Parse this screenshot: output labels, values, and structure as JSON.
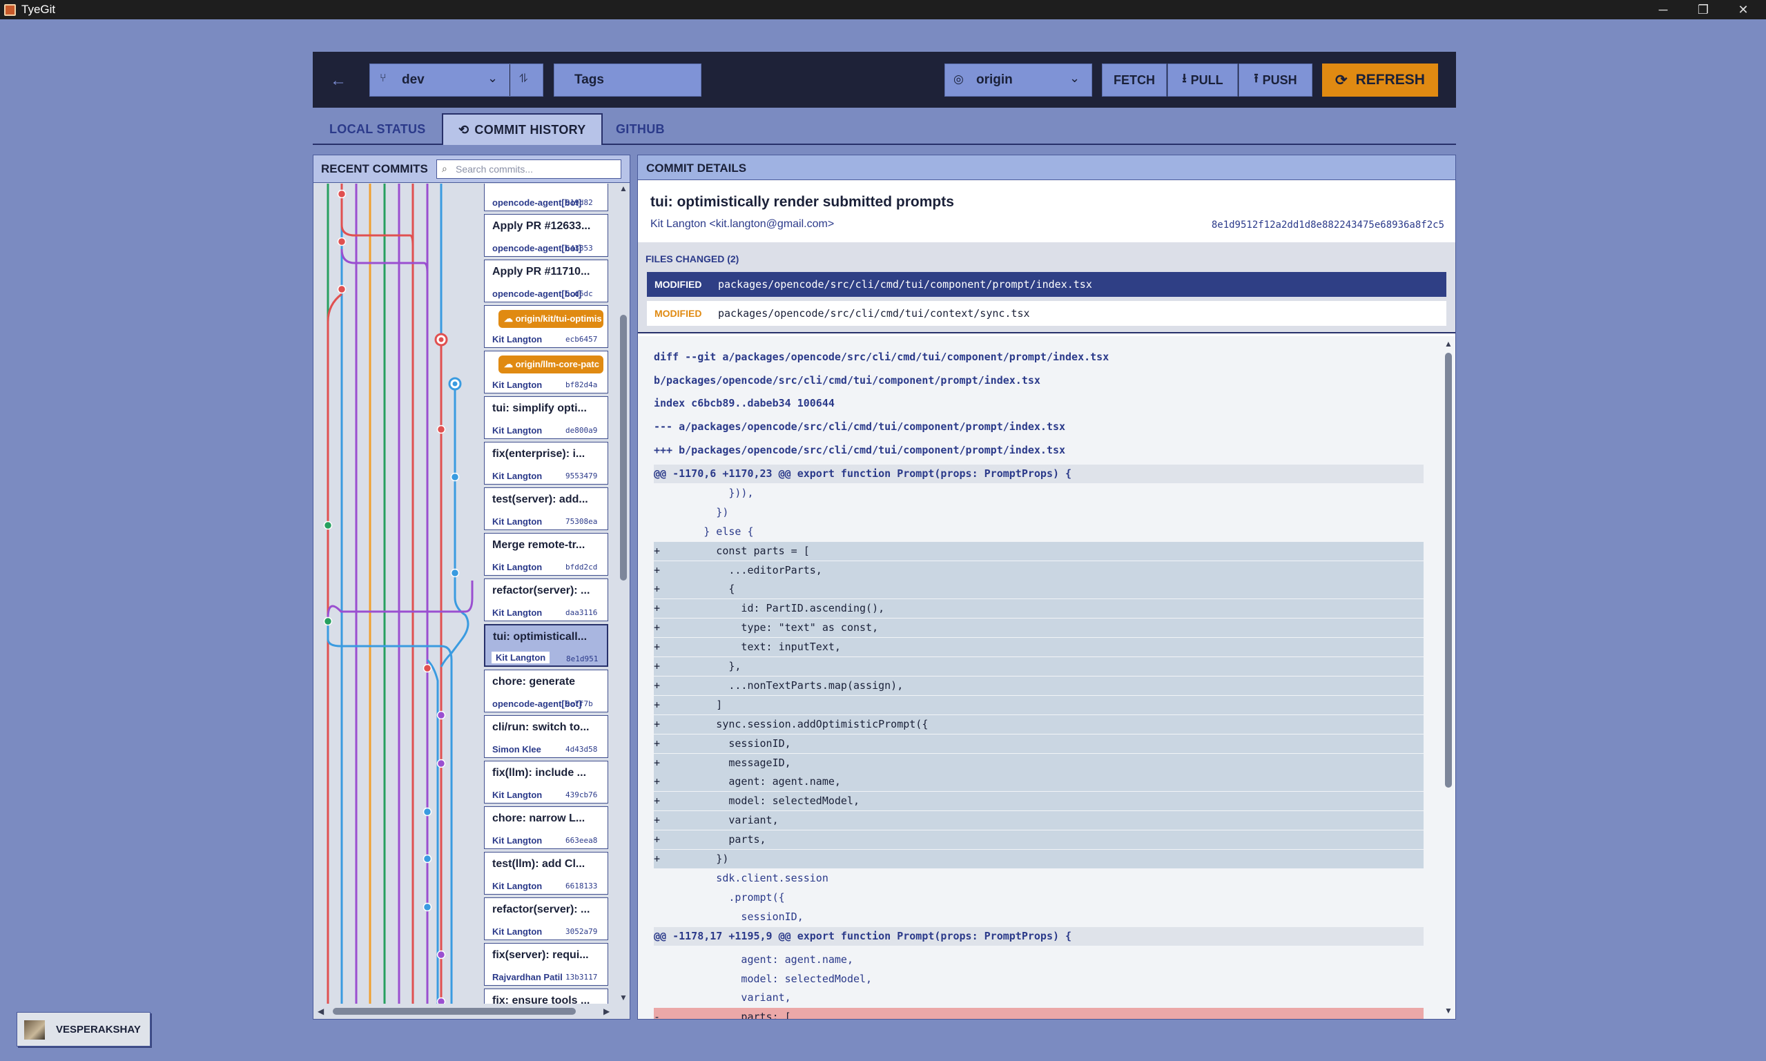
{
  "window": {
    "title": "TyeGit",
    "controls": [
      "─",
      "❐",
      "✕"
    ]
  },
  "toolbar": {
    "branch": "dev",
    "tags_label": "Tags",
    "remote": "origin",
    "fetch_label": "FETCH",
    "pull_label": "PULL",
    "push_label": "PUSH",
    "refresh_label": "REFRESH",
    "accent": "#e08a12"
  },
  "tabs": [
    {
      "label": "LOCAL STATUS"
    },
    {
      "label": "COMMIT HISTORY",
      "active": true
    },
    {
      "label": "GITHUB"
    }
  ],
  "recent_commits": {
    "title": "RECENT COMMITS",
    "search_placeholder": "Search commits...",
    "items": [
      {
        "message": "",
        "author": "opencode-agent[bot]",
        "hash": "919d82"
      },
      {
        "message": "Apply PR #12633...",
        "author": "opencode-agent[bot]",
        "hash": "643853"
      },
      {
        "message": "Apply PR #11710...",
        "author": "opencode-agent[bot]",
        "hash": "5cd6dc"
      },
      {
        "ref": "origin/kit/tui-optimis",
        "author": "Kit Langton",
        "hash": "ecb6457"
      },
      {
        "ref": "origin/llm-core-patc",
        "author": "Kit Langton",
        "hash": "bf82d4a"
      },
      {
        "message": "tui: simplify opti...",
        "author": "Kit Langton",
        "hash": "de800a9"
      },
      {
        "message": "fix(enterprise): i...",
        "author": "Kit Langton",
        "hash": "9553479"
      },
      {
        "message": "test(server): add...",
        "author": "Kit Langton",
        "hash": "75308ea"
      },
      {
        "message": "Merge remote-tr...",
        "author": "Kit Langton",
        "hash": "bfdd2cd"
      },
      {
        "message": "refactor(server): ...",
        "author": "Kit Langton",
        "hash": "daa3116"
      },
      {
        "message": "tui: optimisticall...",
        "author": "Kit Langton",
        "hash": "8e1d951",
        "selected": true
      },
      {
        "message": "chore: generate",
        "author": "opencode-agent[bot]",
        "hash": "9e7f7b"
      },
      {
        "message": "cli/run: switch to...",
        "author": "Simon Klee",
        "hash": "4d43d58"
      },
      {
        "message": "fix(llm): include ...",
        "author": "Kit Langton",
        "hash": "439cb76"
      },
      {
        "message": "chore: narrow L...",
        "author": "Kit Langton",
        "hash": "663eea8"
      },
      {
        "message": "test(llm): add Cl...",
        "author": "Kit Langton",
        "hash": "6618133"
      },
      {
        "message": "refactor(server): ...",
        "author": "Kit Langton",
        "hash": "3052a79"
      },
      {
        "message": "fix(server): requi...",
        "author": "Rajvardhan Patil",
        "hash": "13b3117"
      },
      {
        "message": "fix: ensure tools ...",
        "author": "",
        "hash": ""
      }
    ]
  },
  "commit_details": {
    "title": "COMMIT DETAILS",
    "commit_title": "tui: optimistically render submitted prompts",
    "author": "Kit Langton <kit.langton@gmail.com>",
    "hash": "8e1d9512f12a2dd1d8e882243475e68936a8f2c5",
    "files_title": "FILES CHANGED (2)",
    "files": [
      {
        "status": "MODIFIED",
        "path": "packages/opencode/src/cli/cmd/tui/component/prompt/index.tsx",
        "selected": true
      },
      {
        "status": "MODIFIED",
        "path": "packages/opencode/src/cli/cmd/tui/context/sync.tsx"
      }
    ],
    "diff_lines": [
      {
        "kind": "hdr",
        "text": "diff --git a/packages/opencode/src/cli/cmd/tui/component/prompt/index.tsx"
      },
      {
        "kind": "hdr",
        "text": "b/packages/opencode/src/cli/cmd/tui/component/prompt/index.tsx"
      },
      {
        "kind": "hdr",
        "text": "index c6bcb89..dabeb34 100644"
      },
      {
        "kind": "hdr",
        "text": "--- a/packages/opencode/src/cli/cmd/tui/component/prompt/index.tsx"
      },
      {
        "kind": "hdr",
        "text": "+++ b/packages/opencode/src/cli/cmd/tui/component/prompt/index.tsx"
      },
      {
        "kind": "hunk",
        "text": "@@ -1170,6 +1170,23 @@ export function Prompt(props: PromptProps) {"
      },
      {
        "kind": "ctx",
        "text": "            })),"
      },
      {
        "kind": "ctx",
        "text": "          })"
      },
      {
        "kind": "ctx",
        "text": "        } else {"
      },
      {
        "kind": "add",
        "text": "+         const parts = ["
      },
      {
        "kind": "add",
        "text": "+           ...editorParts,"
      },
      {
        "kind": "add",
        "text": "+           {"
      },
      {
        "kind": "add",
        "text": "+             id: PartID.ascending(),"
      },
      {
        "kind": "add",
        "text": "+             type: \"text\" as const,"
      },
      {
        "kind": "add",
        "text": "+             text: inputText,"
      },
      {
        "kind": "add",
        "text": "+           },"
      },
      {
        "kind": "add",
        "text": "+           ...nonTextParts.map(assign),"
      },
      {
        "kind": "add",
        "text": "+         ]"
      },
      {
        "kind": "add",
        "text": "+         sync.session.addOptimisticPrompt({"
      },
      {
        "kind": "add",
        "text": "+           sessionID,"
      },
      {
        "kind": "add",
        "text": "+           messageID,"
      },
      {
        "kind": "add",
        "text": "+           agent: agent.name,"
      },
      {
        "kind": "add",
        "text": "+           model: selectedModel,"
      },
      {
        "kind": "add",
        "text": "+           variant,"
      },
      {
        "kind": "add",
        "text": "+           parts,"
      },
      {
        "kind": "add",
        "text": "+         })"
      },
      {
        "kind": "ctx",
        "text": "          sdk.client.session"
      },
      {
        "kind": "ctx",
        "text": "            .prompt({"
      },
      {
        "kind": "ctx",
        "text": "              sessionID,"
      },
      {
        "kind": "hunk",
        "text": "@@ -1178,17 +1195,9 @@ export function Prompt(props: PromptProps) {"
      },
      {
        "kind": "ctx",
        "text": "              agent: agent.name,"
      },
      {
        "kind": "ctx",
        "text": "              model: selectedModel,"
      },
      {
        "kind": "ctx",
        "text": "              variant,"
      },
      {
        "kind": "del",
        "text": "-             parts: ["
      }
    ]
  },
  "user": {
    "name": "VESPERAKSHAY"
  },
  "graph_colors": [
    "#e05050",
    "#3a9be0",
    "#9a4fd0",
    "#f0a030",
    "#27a060",
    "#e05050",
    "#3a9be0",
    "#9a4fd0"
  ]
}
